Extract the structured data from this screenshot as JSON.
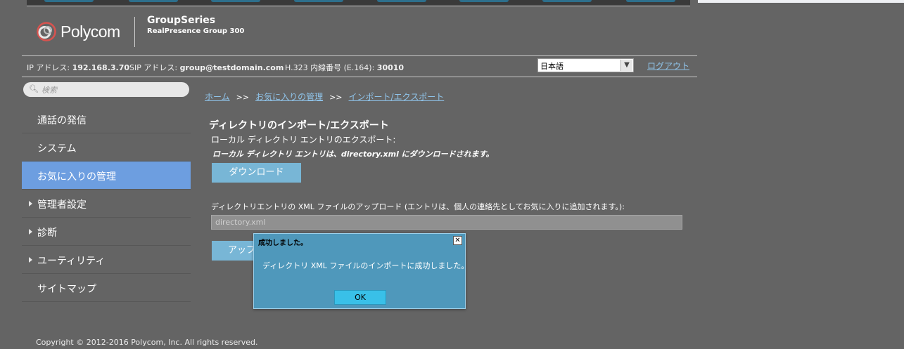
{
  "header": {
    "logo_text": "Polycom",
    "product_name": "GroupSeries",
    "product_model": "RealPresence Group 300"
  },
  "infobar": {
    "ip_label": "IP アドレス:",
    "ip_value": "192.168.3.70",
    "sip_label": "SIP アドレス:",
    "sip_value": "group@testdomain.com",
    "h323_label": "H.323 内線番号 (E.164):",
    "h323_value": "30010",
    "language": "日本語",
    "logout": "ログアウト"
  },
  "search": {
    "placeholder": "検索",
    "icon": "search-icon"
  },
  "sidebar": {
    "items": [
      {
        "label": "通話の発信",
        "expandable": false
      },
      {
        "label": "システム",
        "expandable": false
      },
      {
        "label": "お気に入りの管理",
        "expandable": false,
        "active": true
      },
      {
        "label": "管理者設定",
        "expandable": true
      },
      {
        "label": "診断",
        "expandable": true
      },
      {
        "label": "ユーティリティ",
        "expandable": true
      },
      {
        "label": "サイトマップ",
        "expandable": false
      }
    ]
  },
  "breadcrumb": {
    "home": "ホーム",
    "separator": ">>",
    "favorites": "お気に入りの管理",
    "current": "インポート/エクスポート"
  },
  "main": {
    "title": "ディレクトリのインポート/エクスポート",
    "export_label": "ローカル ディレクトリ エントリのエクスポート:",
    "export_note": "ローカル ディレクトリ エントリは、directory.xml にダウンロードされます。",
    "download_button": "ダウンロード",
    "upload_label": "ディレクトリエントリの XML ファイルのアップロード (エントリは、個人の連絡先としてお気に入りに追加されます。):",
    "file_value": "directory.xml",
    "upload_button": "アップロード"
  },
  "dialog": {
    "title": "成功しました。",
    "message": "ディレクトリ XML ファイルのインポートに成功しました。",
    "ok": "OK"
  },
  "footer": {
    "copyright": "Copyright © 2012-2016 Polycom, Inc. All rights reserved."
  },
  "colors": {
    "background": "#646464",
    "active_nav": "#6d9ee0",
    "button": "#78b6d6",
    "link": "#8fc3e9",
    "dialog": "#4f98bb"
  }
}
